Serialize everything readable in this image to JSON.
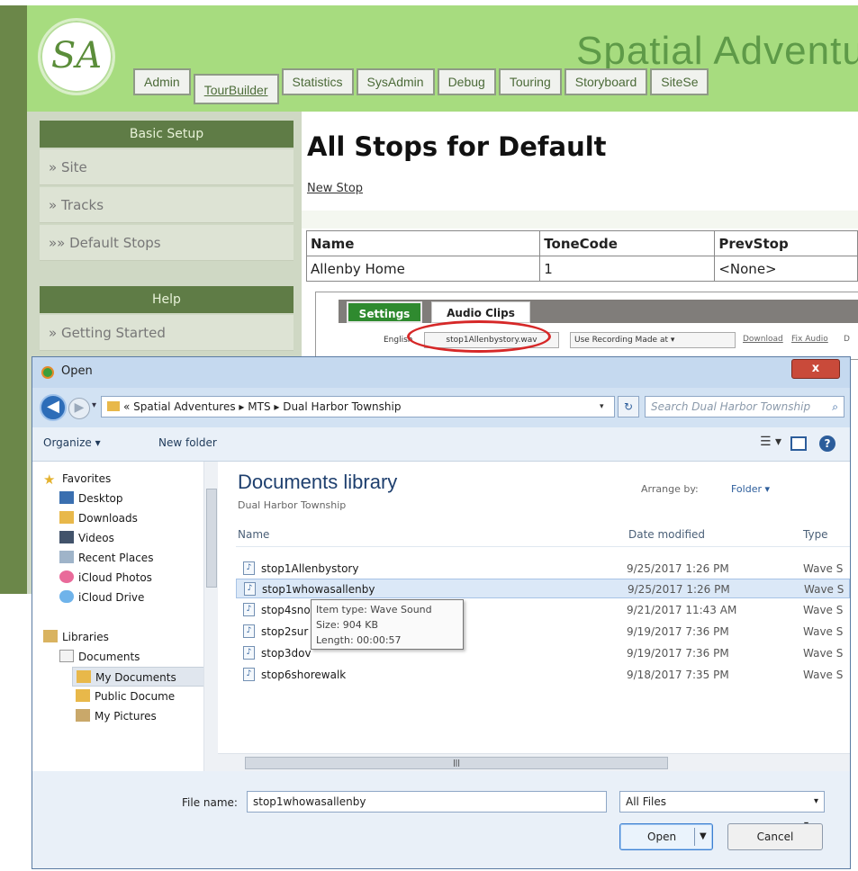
{
  "app": {
    "logo_text": "SA",
    "site_title": "Spatial Adventur",
    "tabs": [
      "Admin",
      "TourBuilder",
      "Statistics",
      "SysAdmin",
      "Debug",
      "Touring",
      "Storyboard",
      "SiteSe"
    ],
    "active_tab": "TourBuilder",
    "sidebar": {
      "basic_setup_header": "Basic Setup",
      "basic_items": [
        "» Site",
        "» Tracks",
        "»» Default Stops"
      ],
      "help_header": "Help",
      "help_items": [
        "» Getting Started"
      ]
    },
    "main": {
      "title": "All Stops for Default",
      "new_stop_link": "New Stop",
      "table": {
        "headers": [
          "Name",
          "ToneCode",
          "PrevStop"
        ],
        "rows": [
          [
            "Allenby Home",
            "1",
            "<None>"
          ]
        ]
      },
      "detail": {
        "settings_tab": "Settings",
        "audio_tab": "Audio Clips",
        "english_label": "English",
        "wav_value": "stop1Allenbystory.wav",
        "recording_select": "Use Recording Made at",
        "download_link": "Download",
        "fix_audio_link": "Fix Audio",
        "trailing_char": "D"
      }
    }
  },
  "dialog": {
    "title": "Open",
    "close_glyph": "x",
    "breadcrumb": "« Spatial Adventures ▸ MTS ▸ Dual Harbor Township",
    "search_placeholder": "Search Dual Harbor Township",
    "toolbar": {
      "organize": "Organize ▾",
      "new_folder": "New folder"
    },
    "nav": {
      "favorites_header": "Favorites",
      "favorites": [
        "Desktop",
        "Downloads",
        "Videos",
        "Recent Places",
        "iCloud Photos",
        "iCloud Drive"
      ],
      "libraries_header": "Libraries",
      "libraries": [
        "Documents"
      ],
      "documents_children": [
        "My Documents",
        "Public Docume",
        "My Pictures"
      ],
      "selected": "My Documents"
    },
    "library": {
      "title": "Documents library",
      "subtitle": "Dual Harbor Township",
      "arrange_by_label": "Arrange by:",
      "arrange_by_value": "Folder ▾"
    },
    "columns": [
      "Name",
      "Date modified",
      "Type"
    ],
    "files": [
      {
        "name": "stop1Allenbystory",
        "date": "9/25/2017 1:26 PM",
        "type": "Wave S"
      },
      {
        "name": "stop1whowasallenby",
        "date": "9/25/2017 1:26 PM",
        "type": "Wave S"
      },
      {
        "name": "stop4snorkelingatthebay",
        "date": "9/21/2017 11:43 AM",
        "type": "Wave S"
      },
      {
        "name": "stop2sur",
        "date": "9/19/2017 7:36 PM",
        "type": "Wave S"
      },
      {
        "name": "stop3dov",
        "date": "9/19/2017 7:36 PM",
        "type": "Wave S"
      },
      {
        "name": "stop6shorewalk",
        "date": "9/18/2017 7:35 PM",
        "type": "Wave S"
      }
    ],
    "selected_file": "stop1whowasallenby",
    "tooltip": {
      "line1": "Item type: Wave Sound",
      "line2": "Size: 904 KB",
      "line3": "Length: 00:00:57"
    },
    "file_name_label": "File name:",
    "file_name_value": "stop1whowasallenby",
    "filter_value": "All Files",
    "open_button": "Open",
    "cancel_button": "Cancel"
  },
  "colors": {
    "header_green": "#a7dc7f",
    "sidebar_head": "#5f7c46",
    "settings_tab": "#2f8a2f",
    "highlight_ellipse": "#d62828",
    "dialog_frame": "#cfe0f2"
  }
}
